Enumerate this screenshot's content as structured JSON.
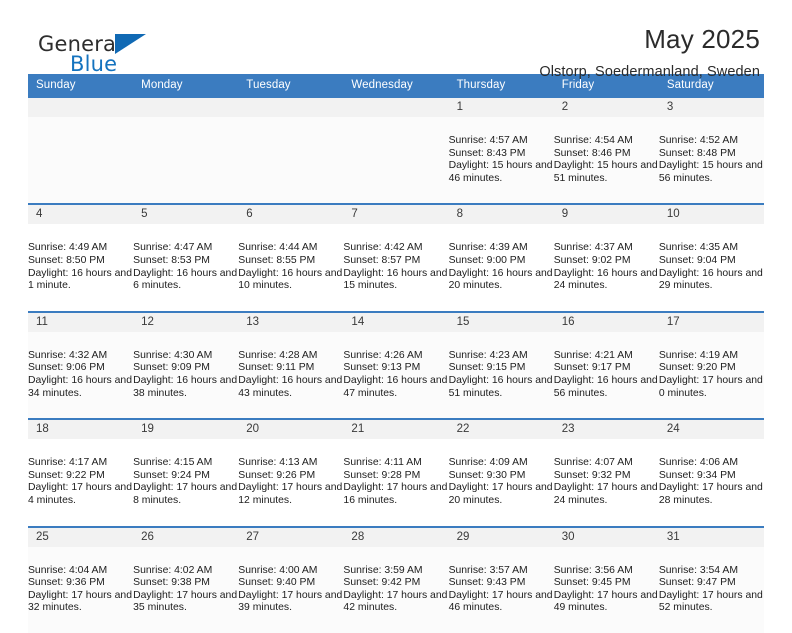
{
  "brand": {
    "word_one": "General",
    "word_two": "Blue",
    "mark": "triangle-logo"
  },
  "header": {
    "title": "May 2025",
    "location": "Olstorp, Soedermanland, Sweden"
  },
  "weekday_headers": [
    "Sunday",
    "Monday",
    "Tuesday",
    "Wednesday",
    "Thursday",
    "Friday",
    "Saturday"
  ],
  "colors": {
    "header_blue": "#3b7cc0",
    "brand_blue": "#1069b4",
    "daynum_band": "#f2f2f2",
    "row_shade": "#fbfbfb",
    "text": "#202020"
  },
  "weeks": [
    [
      {
        "empty": true
      },
      {
        "empty": true
      },
      {
        "empty": true
      },
      {
        "empty": true
      },
      {
        "day": "1",
        "sunrise": "Sunrise: 4:57 AM",
        "sunset": "Sunset: 8:43 PM",
        "daylight": "Daylight: 15 hours and 46 minutes."
      },
      {
        "day": "2",
        "sunrise": "Sunrise: 4:54 AM",
        "sunset": "Sunset: 8:46 PM",
        "daylight": "Daylight: 15 hours and 51 minutes."
      },
      {
        "day": "3",
        "sunrise": "Sunrise: 4:52 AM",
        "sunset": "Sunset: 8:48 PM",
        "daylight": "Daylight: 15 hours and 56 minutes."
      }
    ],
    [
      {
        "day": "4",
        "sunrise": "Sunrise: 4:49 AM",
        "sunset": "Sunset: 8:50 PM",
        "daylight": "Daylight: 16 hours and 1 minute."
      },
      {
        "day": "5",
        "sunrise": "Sunrise: 4:47 AM",
        "sunset": "Sunset: 8:53 PM",
        "daylight": "Daylight: 16 hours and 6 minutes."
      },
      {
        "day": "6",
        "sunrise": "Sunrise: 4:44 AM",
        "sunset": "Sunset: 8:55 PM",
        "daylight": "Daylight: 16 hours and 10 minutes."
      },
      {
        "day": "7",
        "sunrise": "Sunrise: 4:42 AM",
        "sunset": "Sunset: 8:57 PM",
        "daylight": "Daylight: 16 hours and 15 minutes."
      },
      {
        "day": "8",
        "sunrise": "Sunrise: 4:39 AM",
        "sunset": "Sunset: 9:00 PM",
        "daylight": "Daylight: 16 hours and 20 minutes."
      },
      {
        "day": "9",
        "sunrise": "Sunrise: 4:37 AM",
        "sunset": "Sunset: 9:02 PM",
        "daylight": "Daylight: 16 hours and 24 minutes."
      },
      {
        "day": "10",
        "sunrise": "Sunrise: 4:35 AM",
        "sunset": "Sunset: 9:04 PM",
        "daylight": "Daylight: 16 hours and 29 minutes."
      }
    ],
    [
      {
        "day": "11",
        "sunrise": "Sunrise: 4:32 AM",
        "sunset": "Sunset: 9:06 PM",
        "daylight": "Daylight: 16 hours and 34 minutes."
      },
      {
        "day": "12",
        "sunrise": "Sunrise: 4:30 AM",
        "sunset": "Sunset: 9:09 PM",
        "daylight": "Daylight: 16 hours and 38 minutes."
      },
      {
        "day": "13",
        "sunrise": "Sunrise: 4:28 AM",
        "sunset": "Sunset: 9:11 PM",
        "daylight": "Daylight: 16 hours and 43 minutes."
      },
      {
        "day": "14",
        "sunrise": "Sunrise: 4:26 AM",
        "sunset": "Sunset: 9:13 PM",
        "daylight": "Daylight: 16 hours and 47 minutes."
      },
      {
        "day": "15",
        "sunrise": "Sunrise: 4:23 AM",
        "sunset": "Sunset: 9:15 PM",
        "daylight": "Daylight: 16 hours and 51 minutes."
      },
      {
        "day": "16",
        "sunrise": "Sunrise: 4:21 AM",
        "sunset": "Sunset: 9:17 PM",
        "daylight": "Daylight: 16 hours and 56 minutes."
      },
      {
        "day": "17",
        "sunrise": "Sunrise: 4:19 AM",
        "sunset": "Sunset: 9:20 PM",
        "daylight": "Daylight: 17 hours and 0 minutes."
      }
    ],
    [
      {
        "day": "18",
        "sunrise": "Sunrise: 4:17 AM",
        "sunset": "Sunset: 9:22 PM",
        "daylight": "Daylight: 17 hours and 4 minutes."
      },
      {
        "day": "19",
        "sunrise": "Sunrise: 4:15 AM",
        "sunset": "Sunset: 9:24 PM",
        "daylight": "Daylight: 17 hours and 8 minutes."
      },
      {
        "day": "20",
        "sunrise": "Sunrise: 4:13 AM",
        "sunset": "Sunset: 9:26 PM",
        "daylight": "Daylight: 17 hours and 12 minutes."
      },
      {
        "day": "21",
        "sunrise": "Sunrise: 4:11 AM",
        "sunset": "Sunset: 9:28 PM",
        "daylight": "Daylight: 17 hours and 16 minutes."
      },
      {
        "day": "22",
        "sunrise": "Sunrise: 4:09 AM",
        "sunset": "Sunset: 9:30 PM",
        "daylight": "Daylight: 17 hours and 20 minutes."
      },
      {
        "day": "23",
        "sunrise": "Sunrise: 4:07 AM",
        "sunset": "Sunset: 9:32 PM",
        "daylight": "Daylight: 17 hours and 24 minutes."
      },
      {
        "day": "24",
        "sunrise": "Sunrise: 4:06 AM",
        "sunset": "Sunset: 9:34 PM",
        "daylight": "Daylight: 17 hours and 28 minutes."
      }
    ],
    [
      {
        "day": "25",
        "sunrise": "Sunrise: 4:04 AM",
        "sunset": "Sunset: 9:36 PM",
        "daylight": "Daylight: 17 hours and 32 minutes."
      },
      {
        "day": "26",
        "sunrise": "Sunrise: 4:02 AM",
        "sunset": "Sunset: 9:38 PM",
        "daylight": "Daylight: 17 hours and 35 minutes."
      },
      {
        "day": "27",
        "sunrise": "Sunrise: 4:00 AM",
        "sunset": "Sunset: 9:40 PM",
        "daylight": "Daylight: 17 hours and 39 minutes."
      },
      {
        "day": "28",
        "sunrise": "Sunrise: 3:59 AM",
        "sunset": "Sunset: 9:42 PM",
        "daylight": "Daylight: 17 hours and 42 minutes."
      },
      {
        "day": "29",
        "sunrise": "Sunrise: 3:57 AM",
        "sunset": "Sunset: 9:43 PM",
        "daylight": "Daylight: 17 hours and 46 minutes."
      },
      {
        "day": "30",
        "sunrise": "Sunrise: 3:56 AM",
        "sunset": "Sunset: 9:45 PM",
        "daylight": "Daylight: 17 hours and 49 minutes."
      },
      {
        "day": "31",
        "sunrise": "Sunrise: 3:54 AM",
        "sunset": "Sunset: 9:47 PM",
        "daylight": "Daylight: 17 hours and 52 minutes."
      }
    ]
  ]
}
